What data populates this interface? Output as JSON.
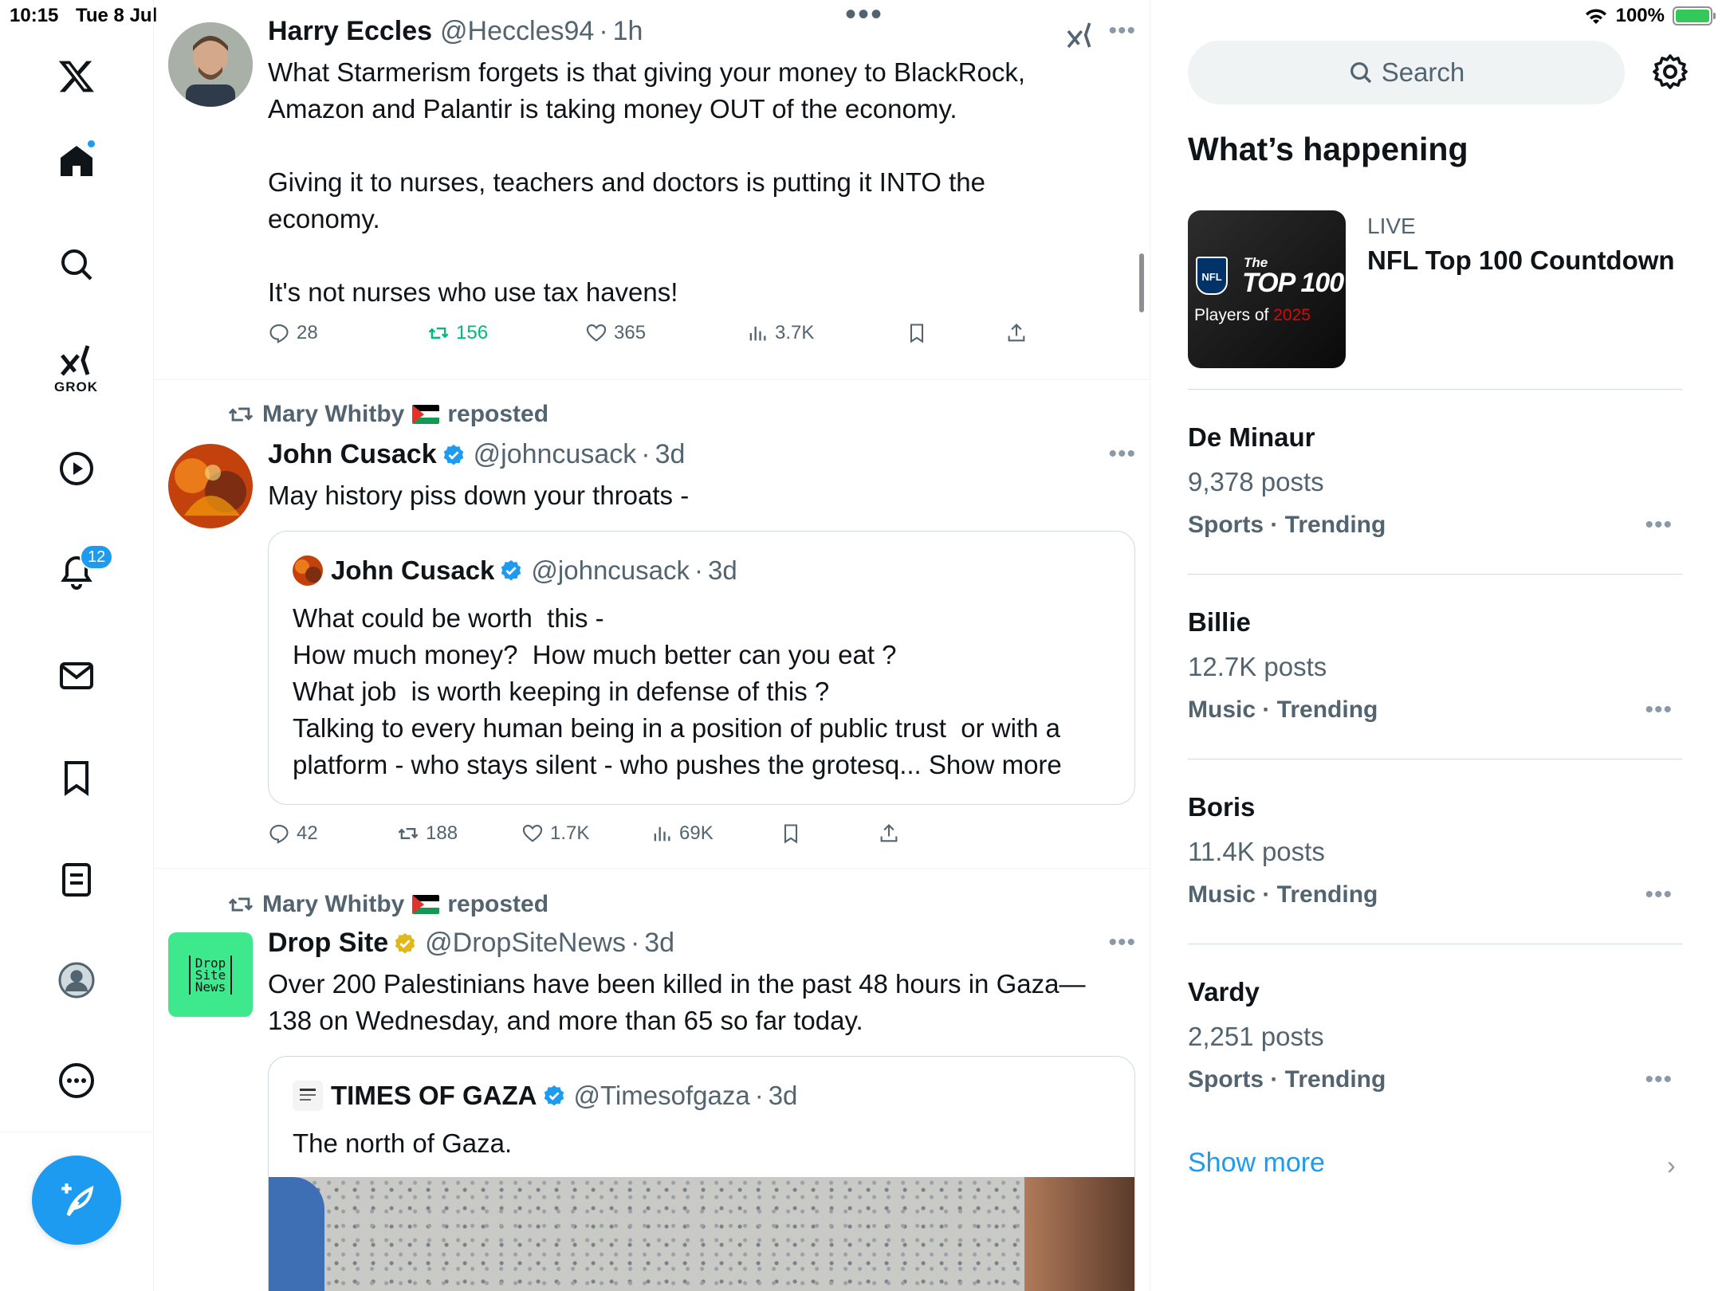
{
  "status": {
    "time": "10:15",
    "date": "Tue 8 Jul",
    "battery": "100%"
  },
  "nav": {
    "grok_label": "GROK",
    "notification_count": "12"
  },
  "posts": [
    {
      "name": "Harry Eccles",
      "handle": "@Heccles94",
      "time": "1h",
      "text": "What Starmerism forgets is that giving your money to BlackRock,\nAmazon and Palantir is taking money OUT of the economy.\n\nGiving it to nurses, teachers and doctors is putting it INTO the\neconomy.\n\nIt's not nurses who use tax havens!",
      "replies": "28",
      "reposts": "156",
      "likes": "365",
      "views": "3.7K"
    },
    {
      "repost_by": "Mary Whitby",
      "repost_suffix": "reposted",
      "name": "John Cusack",
      "handle": "@johncusack",
      "time": "3d",
      "text": "May history piss down your throats -",
      "quote": {
        "name": "John Cusack",
        "handle": "@johncusack",
        "time": "3d",
        "text": "What could be worth  this -\nHow much money?  How much better can you eat ?\nWhat job  is worth keeping in defense of this ?\nTalking to every human being in a position of public trust  or with a\nplatform - who stays silent - who pushes the grotesq... Show more"
      },
      "replies": "42",
      "reposts": "188",
      "likes": "1.7K",
      "views": "69K"
    },
    {
      "repost_by": "Mary Whitby",
      "repost_suffix": "reposted",
      "name": "Drop Site",
      "handle": "@DropSiteNews",
      "time": "3d",
      "avatar_text": "Drop\nSite\nNews",
      "text": "Over 200 Palestinians have been killed in the past 48 hours in Gaza—\n138 on Wednesday, and more than 65 so far today.",
      "quote": {
        "name": "TIMES OF GAZA",
        "handle": "@Timesofgaza",
        "time": "3d",
        "text": "The north of Gaza."
      }
    }
  ],
  "sidebar": {
    "search_placeholder": "Search",
    "whats_happening": "What’s happening",
    "live": {
      "label": "LIVE",
      "title": "NFL Top 100 Countdown",
      "img_line1": "The",
      "img_line2": "TOP 100",
      "img_line3": "Players of",
      "img_year": "2025",
      "img_logo": "NFL"
    },
    "trends": [
      {
        "name": "De Minaur",
        "posts": "9,378 posts",
        "category": "Sports · Trending"
      },
      {
        "name": "Billie",
        "posts": "12.7K posts",
        "category": "Music · Trending"
      },
      {
        "name": "Boris",
        "posts": "11.4K posts",
        "category": "Music · Trending"
      },
      {
        "name": "Vardy",
        "posts": "2,251 posts",
        "category": "Sports · Trending"
      }
    ],
    "show_more": "Show more"
  },
  "colors": {
    "accent": "#1d9bf0",
    "repost_green": "#00ba7c",
    "secondary_text": "#536471"
  }
}
